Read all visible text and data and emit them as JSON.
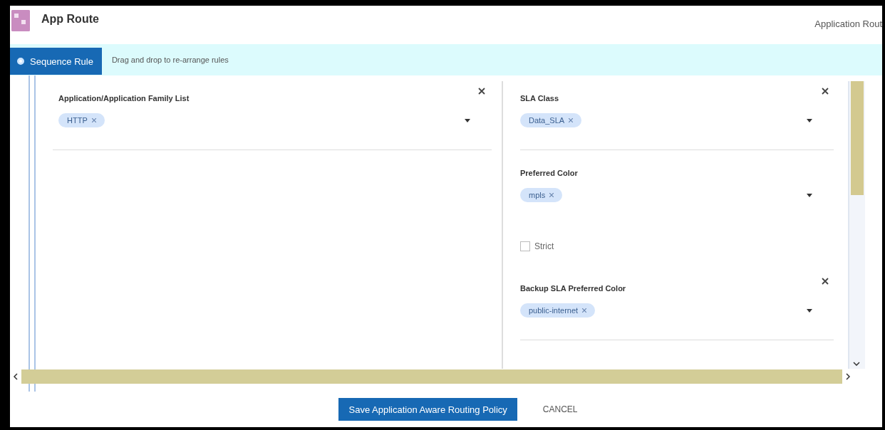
{
  "header": {
    "title": "App Route",
    "breadcrumb": "Application Rout"
  },
  "sequence_bar": {
    "button": "Sequence Rule",
    "hint": "Drag and drop to re-arrange rules"
  },
  "match_card": {
    "label": "Application/Application Family List",
    "chips": [
      "HTTP"
    ]
  },
  "action_fields": [
    {
      "kind": "select",
      "label": "SLA Class",
      "chips": [
        "Data_SLA"
      ],
      "closable": true
    },
    {
      "kind": "select",
      "label": "Preferred Color",
      "chips": [
        "mpls"
      ],
      "closable": false
    },
    {
      "kind": "checkbox",
      "label": "Strict",
      "checked": false
    },
    {
      "kind": "select",
      "label": "Backup SLA Preferred Color",
      "chips": [
        "public-internet"
      ],
      "closable": true
    }
  ],
  "footer": {
    "buttons": [
      {
        "label": "Save Application Aware Routing Policy",
        "kind": "primary"
      },
      {
        "label": "CANCEL",
        "kind": "text"
      }
    ]
  }
}
